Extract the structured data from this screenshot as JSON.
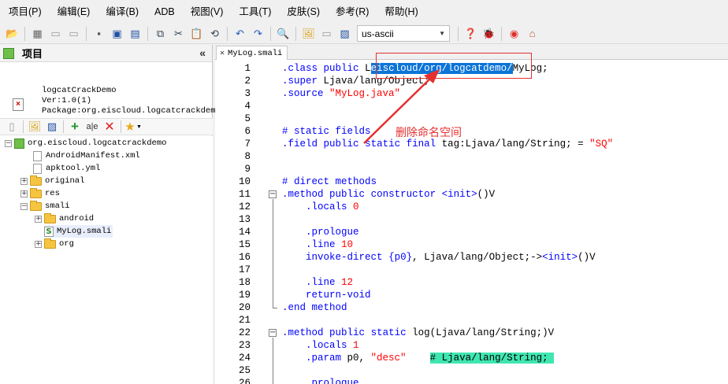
{
  "menu": [
    "项目(P)",
    "编辑(E)",
    "编译(B)",
    "ADB",
    "视图(V)",
    "工具(T)",
    "皮肤(S)",
    "参考(R)",
    "帮助(H)"
  ],
  "toolbar": {
    "encoding": "us-ascii"
  },
  "panel": {
    "title": "项目",
    "collapse": "«",
    "info": [
      "logcatCrackDemo",
      "Ver:1.0(1)",
      "Package:org.eiscloud.logcatcrackdem"
    ]
  },
  "tree": [
    {
      "label": "org.eiscloud.logcatcrackdemo",
      "type": "project"
    },
    {
      "label": "AndroidManifest.xml",
      "type": "file"
    },
    {
      "label": "apktool.yml",
      "type": "file"
    },
    {
      "label": "original",
      "type": "folder"
    },
    {
      "label": "res",
      "type": "folder"
    },
    {
      "label": "smali",
      "type": "folder"
    },
    {
      "label": "android",
      "type": "folder"
    },
    {
      "label": "MyLog.smali",
      "type": "smali"
    },
    {
      "label": "org",
      "type": "folder"
    }
  ],
  "editor": {
    "tab": "MyLog.smali",
    "annotation": "删除命名空间",
    "lines": [
      ".class public Leiscloud/org/logcatdemo/MyLog;",
      ".super Ljava/lang/Object;",
      ".source \"MyLog.java\"",
      "",
      "",
      "# static fields",
      ".field public static final tag:Ljava/lang/String; = \"SQ\"",
      "",
      "",
      "# direct methods",
      ".method public constructor <init>()V",
      "    .locals 0",
      "",
      "    .prologue",
      "    .line 10",
      "    invoke-direct {p0}, Ljava/lang/Object;-><init>()V",
      "",
      "    .line 12",
      "    return-void",
      ".end method",
      "",
      ".method public static log(Ljava/lang/String;)V",
      "    .locals 1",
      "    .param p0, \"desc\"    # Ljava/lang/String;",
      "",
      "    .prologue"
    ]
  }
}
